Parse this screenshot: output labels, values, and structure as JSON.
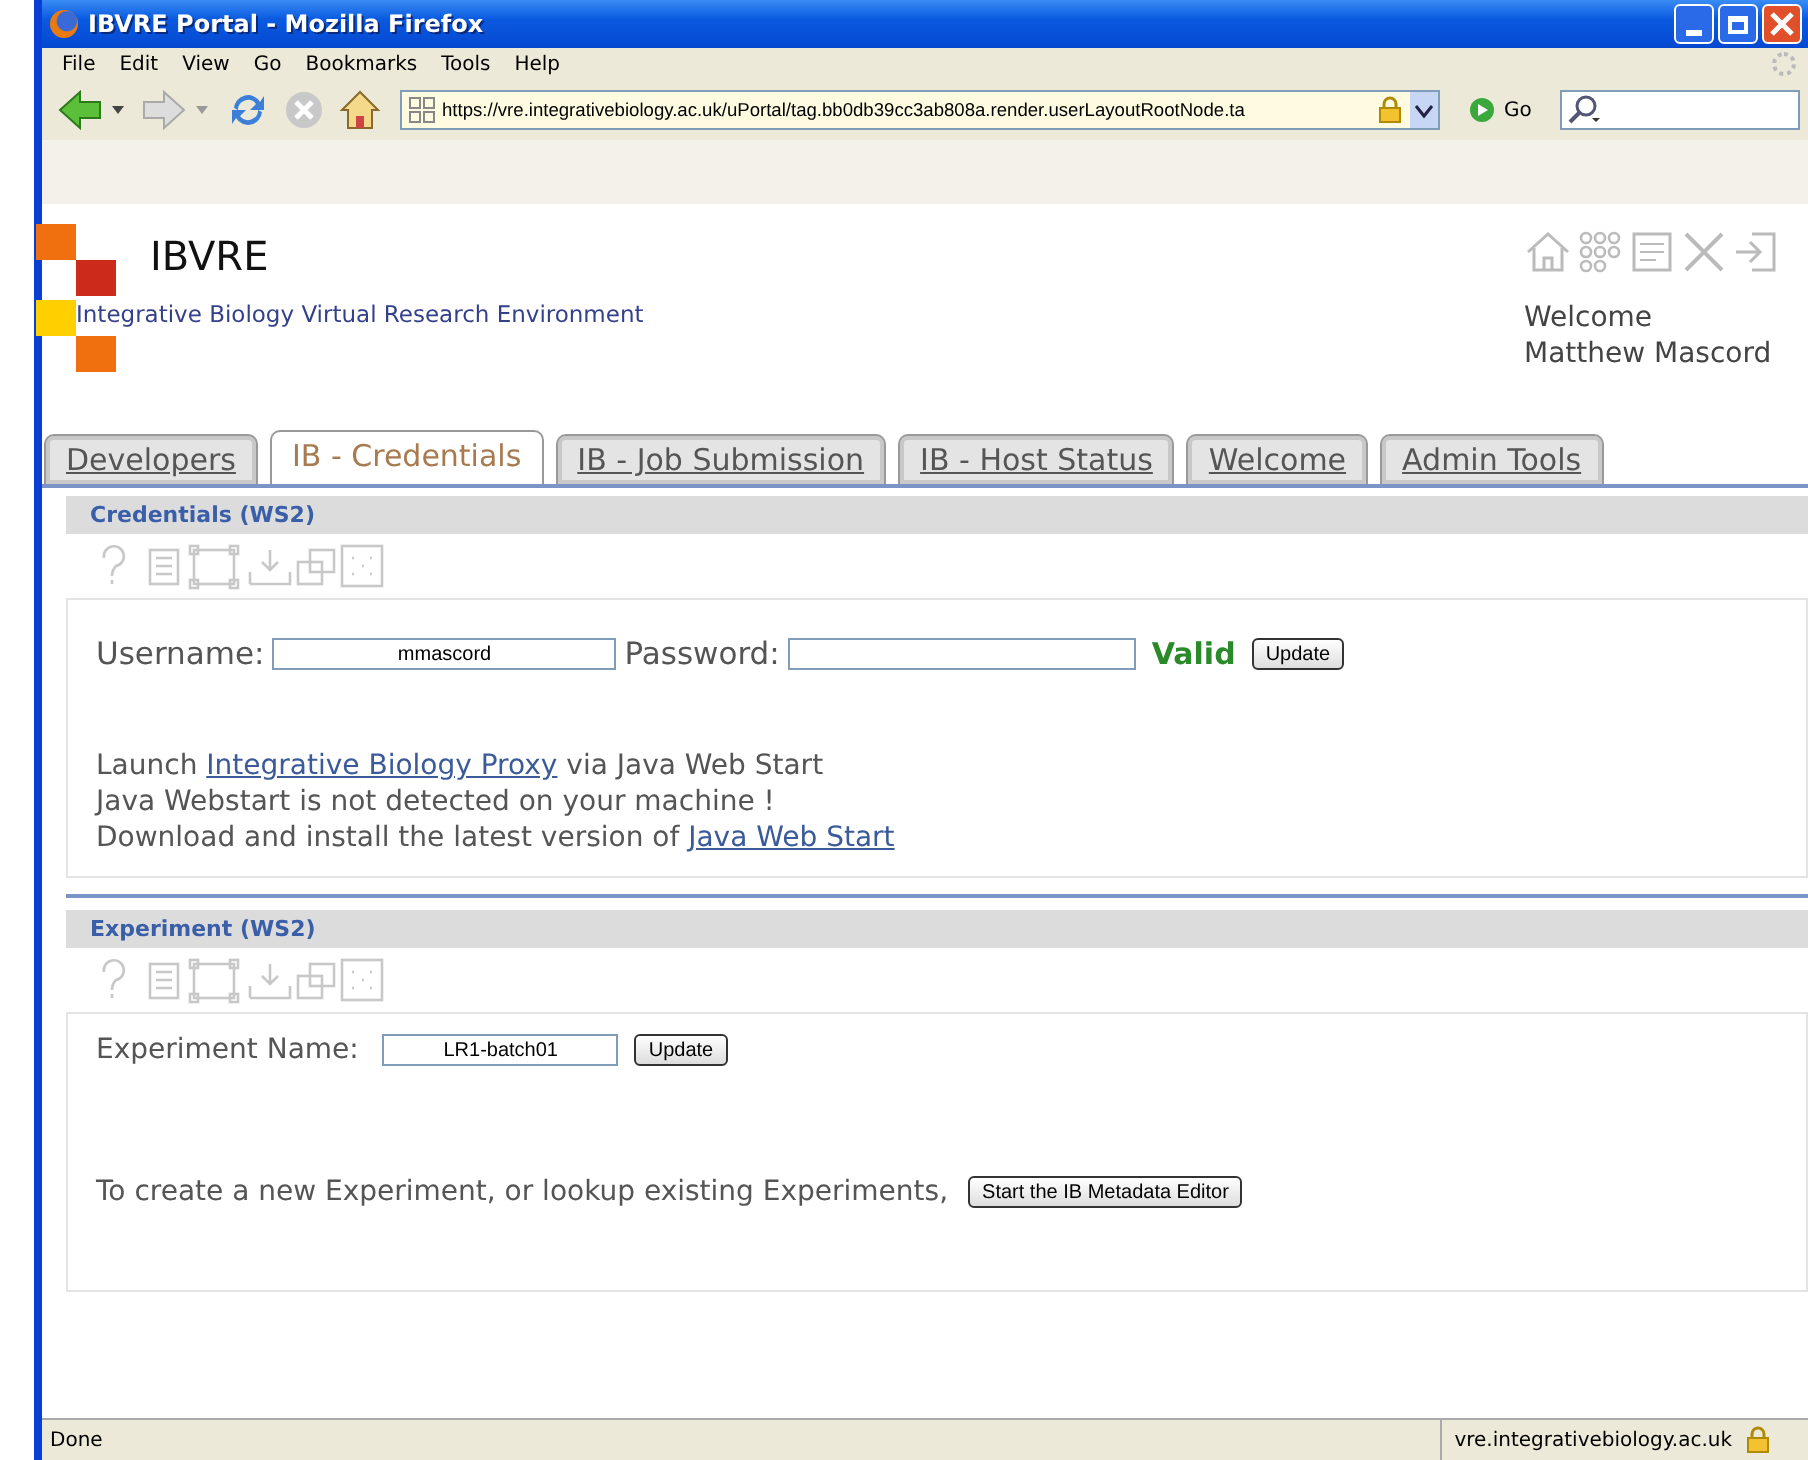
{
  "window": {
    "title": "IBVRE Portal - Mozilla Firefox"
  },
  "menu": [
    "File",
    "Edit",
    "View",
    "Go",
    "Bookmarks",
    "Tools",
    "Help"
  ],
  "toolbar": {
    "url": "https://vre.integrativebiology.ac.uk/uPortal/tag.bb0db39cc3ab808a.render.userLayoutRootNode.ta",
    "go": "Go"
  },
  "header": {
    "site_title": "IBVRE",
    "subtitle": "Integrative Biology Virtual Research Environment",
    "welcome": [
      "Welcome",
      "Matthew Mascord"
    ]
  },
  "tabs": [
    {
      "label": "Developers",
      "selected": false
    },
    {
      "label": "IB - Credentials",
      "selected": true
    },
    {
      "label": "IB - Job Submission",
      "selected": false
    },
    {
      "label": "IB - Host Status",
      "selected": false
    },
    {
      "label": "Welcome",
      "selected": false
    },
    {
      "label": "Admin Tools",
      "selected": false
    }
  ],
  "credentials": {
    "title": "Credentials (WS2)",
    "username_label": "Username:",
    "username": "mmascord",
    "password_label": "Password:",
    "status": "Valid",
    "button": "Update",
    "lines": [
      [
        {
          "kind": "text",
          "text": "Launch "
        },
        {
          "kind": "link",
          "text": "Integrative Biology Proxy"
        },
        {
          "kind": "text",
          "text": " via Java Web Start"
        }
      ],
      [
        {
          "kind": "text",
          "text": "Java Webstart is not detected on your machine !"
        }
      ],
      [
        {
          "kind": "text",
          "text": "Download and install the latest version of "
        },
        {
          "kind": "link",
          "text": "Java Web Start"
        }
      ]
    ]
  },
  "experiment": {
    "title": "Experiment (WS2)",
    "name_label": "Experiment Name:",
    "name": "LR1-batch01",
    "button": "Update",
    "prompt": "To create a new Experiment, or lookup existing Experiments,",
    "editor_button": "Start the IB Metadata Editor"
  },
  "status_bar": {
    "status": "Done",
    "host": "vre.integrativebiology.ac.uk"
  }
}
